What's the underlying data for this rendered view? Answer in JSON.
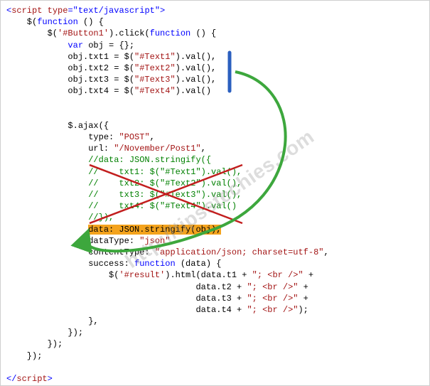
{
  "watermark": "http://tipsstechies.com",
  "code": {
    "l01a": "<",
    "l01b": "script",
    "l01c": " ",
    "l01d": "type",
    "l01e": "=\"text/javascript\">",
    "l02": "    $(",
    "l02b": "function",
    "l02c": " () {",
    "l03": "        $(",
    "l03s": "'#Button1'",
    "l03c": ").click(",
    "l03d": "function",
    "l03e": " () {",
    "l04": "            ",
    "l04b": "var",
    "l04c": " obj = {};",
    "l05": "            obj.txt1 = $(",
    "l05s": "\"#Text1\"",
    "l05c": ").val(),",
    "l06": "            obj.txt2 = $(",
    "l06s": "\"#Text2\"",
    "l06c": ").val(),",
    "l07": "            obj.txt3 = $(",
    "l07s": "\"#Text3\"",
    "l07c": ").val(),",
    "l08": "            obj.txt4 = $(",
    "l08s": "\"#Text4\"",
    "l08c": ").val()",
    "l09": "",
    "l10": "",
    "l11": "            $.ajax({",
    "l12": "                type: ",
    "l12s": "\"POST\"",
    "l12c": ",",
    "l13": "                url: ",
    "l13s": "\"/November/Post1\"",
    "l13c": ",",
    "l14": "                //data: JSON.stringify({",
    "l15": "                //    txt1: $(\"#Text1\").val(),",
    "l16": "                //    txt2: $(\"#Text2\").val(),",
    "l17": "                //    txt3: $(\"#Text3\").val(),",
    "l18": "                //    txt4: $(\"#Text4\").val()",
    "l19": "                //}),",
    "l20a": "                ",
    "l20b": "data: JSON.stringify(obj),",
    "l21": "                dataType: ",
    "l21s": "\"json\"",
    "l21c": ",",
    "l22": "                contentType: ",
    "l22s": "\"application/json; charset=utf-8\"",
    "l22c": ",",
    "l23": "                success: ",
    "l23b": "function",
    "l23c": " (data) {",
    "l24": "                    $(",
    "l24s": "'#result'",
    "l24c": ").html(data.t1 + ",
    "l24d": "\"; <br />\"",
    "l24e": " +",
    "l25": "                                     data.t2 + ",
    "l25s": "\"; <br />\"",
    "l25c": " +",
    "l26": "                                     data.t3 + ",
    "l26s": "\"; <br />\"",
    "l26c": " +",
    "l27": "                                     data.t4 + ",
    "l27s": "\"; <br />\"",
    "l27c": ");",
    "l28": "                },",
    "l29": "            });",
    "l30": "        });",
    "l31": "    });",
    "l32": "",
    "l33a": "</",
    "l33b": "script",
    "l33c": ">"
  }
}
